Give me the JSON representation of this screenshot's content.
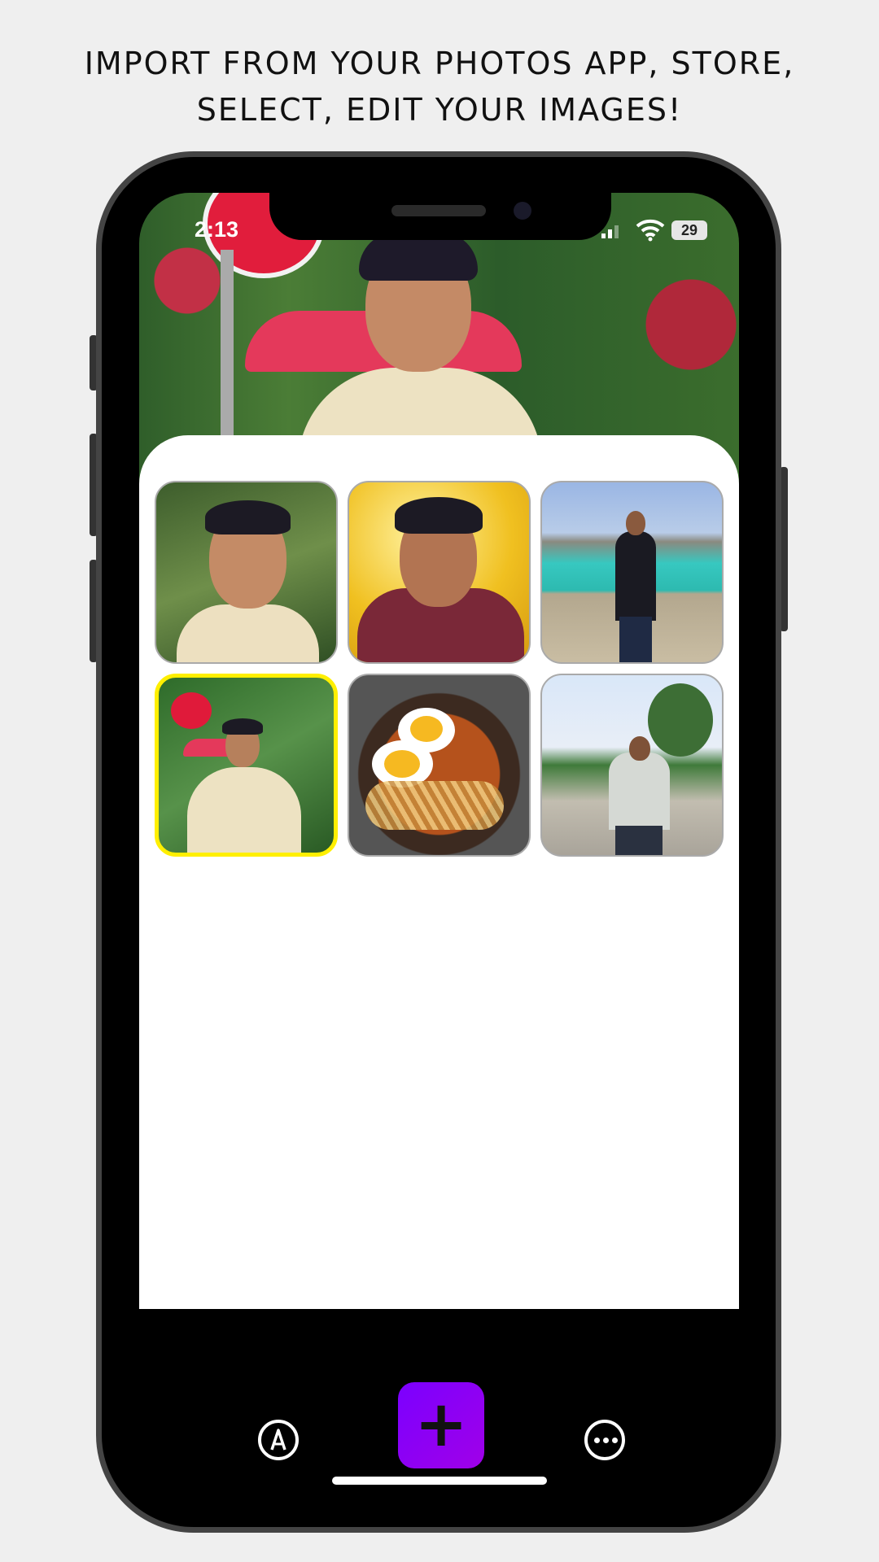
{
  "headline": {
    "line1": "IMPORT FROM YOUR PHOTOS APP, STORE,",
    "line2": "SELECT, EDIT YOUR IMAGES!"
  },
  "status_bar": {
    "time": "2:13",
    "battery": "29",
    "icons": [
      "signal-icon",
      "wifi-icon",
      "battery-icon"
    ]
  },
  "hero": {
    "description_icon": "profile-photo"
  },
  "gallery": {
    "selected_index": 3,
    "selection_color": "#ffef00",
    "tiles": [
      {
        "name": "photo-portrait-garden"
      },
      {
        "name": "photo-portrait-yellow"
      },
      {
        "name": "photo-standing-water"
      },
      {
        "name": "photo-standing-flowers"
      },
      {
        "name": "photo-noodle-bowl"
      },
      {
        "name": "photo-standing-road"
      }
    ]
  },
  "tabbar": {
    "left_icon": "draw-icon",
    "center_label": "+",
    "center_color": "#8a00f5",
    "right_icon": "more-icon"
  }
}
